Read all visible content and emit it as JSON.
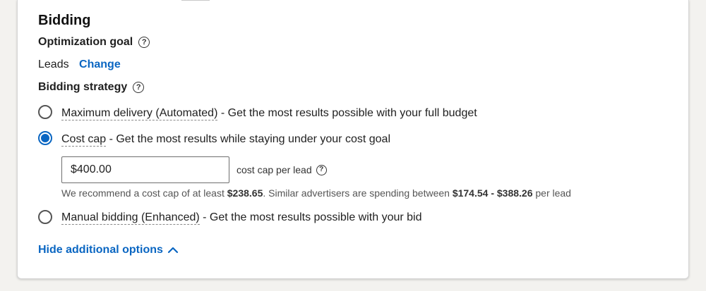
{
  "bidding": {
    "title": "Bidding",
    "optimization_goal_label": "Optimization goal",
    "goal_value": "Leads",
    "change_label": "Change",
    "strategy_label": "Bidding strategy",
    "options": [
      {
        "name": "Maximum delivery (Automated)",
        "description": " - Get the most results possible with your full budget",
        "selected": false
      },
      {
        "name": "Cost cap",
        "description": " - Get the most results while staying under your cost goal",
        "selected": true
      },
      {
        "name": "Manual bidding (Enhanced)",
        "description": " - Get the most results possible with your bid",
        "selected": false
      }
    ],
    "cost_cap": {
      "value": "$400.00",
      "unit_label": "cost cap per lead",
      "recommend_prefix": "We recommend a cost cap of at least ",
      "recommend_min": "$238.65",
      "recommend_middle": ". Similar advertisers are spending between ",
      "recommend_range": "$174.54 - $388.26",
      "recommend_suffix": " per lead"
    },
    "hide_options_label": "Hide additional options"
  },
  "colors": {
    "link": "#0a66c2",
    "radio_selected": "#0a66c2",
    "text": "#1f1f1f"
  },
  "icons": {
    "help": "question-circle-icon",
    "chevron": "chevron-up-icon"
  }
}
